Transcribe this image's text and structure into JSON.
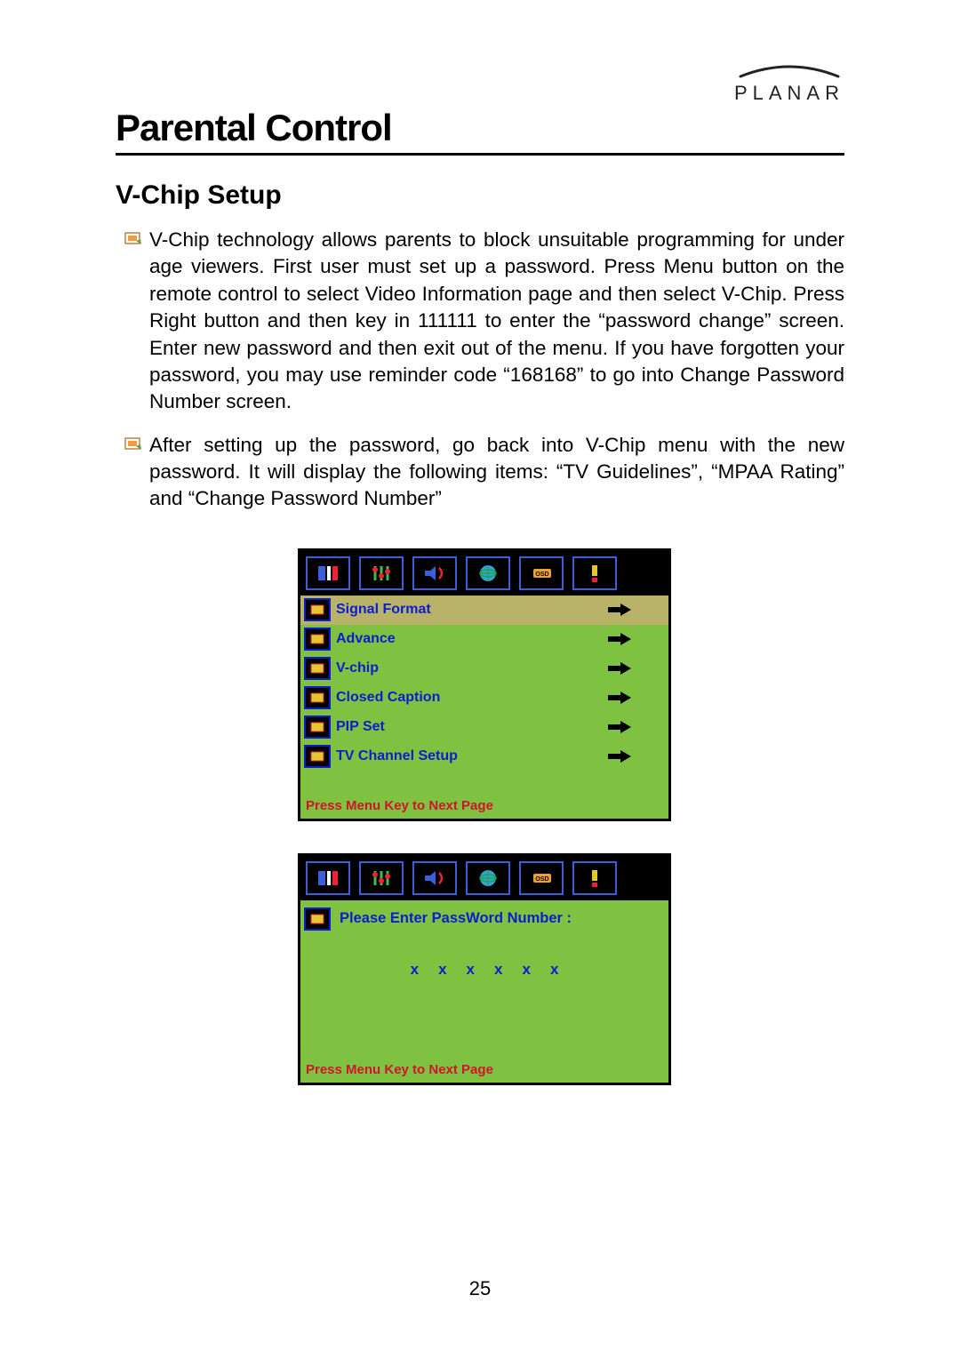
{
  "brand": {
    "name": "PLANAR"
  },
  "section_title": "Parental Control",
  "sub_title": "V-Chip Setup",
  "paragraphs": [
    "V-Chip technology allows parents to block unsuitable programming for under age viewers. First user must set up a password. Press Menu button on the remote control to select Video Information page and then select V-Chip. Press Right button and then key in 111111 to enter the “password change” screen. Enter new password and then exit out of the menu.  If you have forgotten your password, you may use reminder code “168168” to go into Change Password Number screen.",
    "After setting up the password, go back into V-Chip menu with the new password. It will display the following items: “TV Guidelines”, “MPAA Rating” and “Change Password Number”"
  ],
  "osd1": {
    "tabs": [
      "video-icon",
      "tuning-icon",
      "audio-icon",
      "globe-icon",
      "osd-icon",
      "alert-icon"
    ],
    "rows": [
      {
        "icon": "signal-icon",
        "label": "Signal Format",
        "selected": true
      },
      {
        "icon": "advance-icon",
        "label": "Advance",
        "selected": false
      },
      {
        "icon": "vchip-icon",
        "label": "V-chip",
        "selected": false
      },
      {
        "icon": "cc-icon",
        "label": "Closed Caption",
        "selected": false
      },
      {
        "icon": "pip-icon",
        "label": "PIP Set",
        "selected": false
      },
      {
        "icon": "channel-icon",
        "label": "TV Channel Setup",
        "selected": false
      }
    ],
    "footer": "Press Menu Key to Next Page"
  },
  "osd2": {
    "tabs": [
      "video-icon",
      "tuning-icon",
      "audio-icon",
      "globe-icon",
      "osd-icon",
      "alert-icon"
    ],
    "prompt_icon": "vchip-icon",
    "prompt": "Please Enter PassWord Number :",
    "digits": [
      "x",
      "x",
      "x",
      "x",
      "x",
      "x"
    ],
    "footer": "Press Menu Key to Next Page"
  },
  "page_number": "25"
}
